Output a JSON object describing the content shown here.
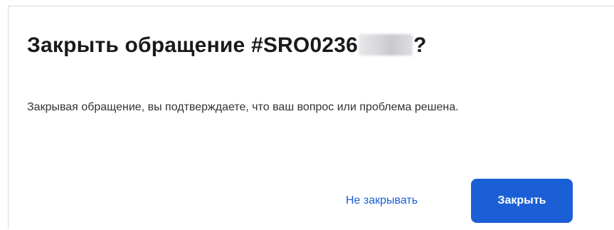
{
  "dialog": {
    "title_prefix": "Закрыть обращение #SRO0236",
    "title_suffix": "?",
    "body": "Закрывая обращение, вы подтверждаете, что ваш вопрос или проблема решена.",
    "cancel_label": "Не закрывать",
    "confirm_label": "Закрыть"
  },
  "colors": {
    "accent": "#1b5fd6",
    "title": "#1a1a1a",
    "body_text": "#333333",
    "border": "#d9d9de"
  }
}
